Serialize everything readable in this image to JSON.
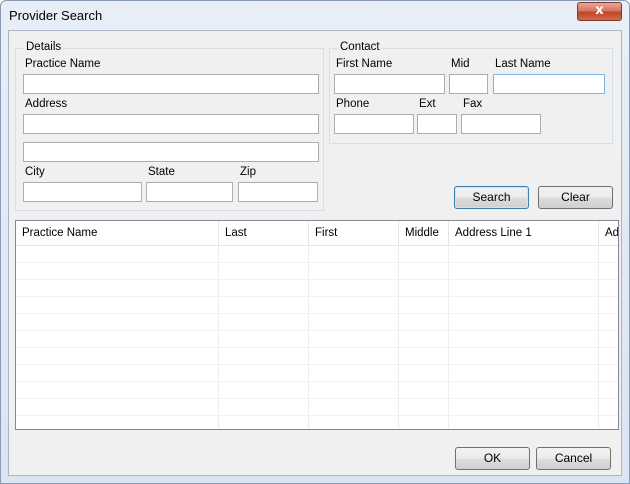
{
  "window": {
    "title": "Provider Search",
    "close_glyph": "x"
  },
  "details": {
    "legend": "Details",
    "practice_name_label": "Practice Name",
    "practice_name_value": "",
    "address_label": "Address",
    "address_line1_value": "",
    "address_line2_value": "",
    "city_label": "City",
    "city_value": "",
    "state_label": "State",
    "state_value": "",
    "zip_label": "Zip",
    "zip_value": ""
  },
  "contact": {
    "legend": "Contact",
    "first_name_label": "First Name",
    "first_name_value": "",
    "mid_label": "Mid",
    "mid_value": "",
    "last_name_label": "Last Name",
    "last_name_value": "",
    "phone_label": "Phone",
    "phone_value": "",
    "ext_label": "Ext",
    "ext_value": "",
    "fax_label": "Fax",
    "fax_value": ""
  },
  "actions": {
    "search_label": "Search",
    "clear_label": "Clear"
  },
  "results": {
    "columns": [
      "Practice Name",
      "Last",
      "First",
      "Middle",
      "Address Line 1",
      "Ad"
    ],
    "rows": []
  },
  "footer": {
    "ok_label": "OK",
    "cancel_label": "Cancel"
  }
}
